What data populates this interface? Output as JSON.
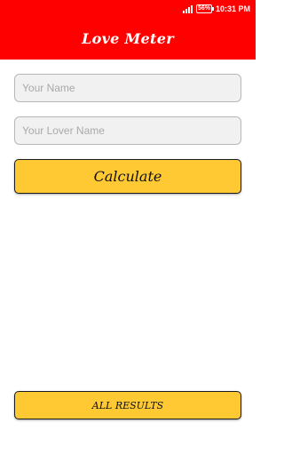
{
  "status_bar": {
    "battery": "56%",
    "time": "10:31 PM"
  },
  "app_bar": {
    "title": "Love Meter"
  },
  "form": {
    "name_placeholder": "Your Name",
    "name_value": "",
    "lover_placeholder": "Your Lover Name",
    "lover_value": "",
    "calculate_label": "Calculate"
  },
  "footer": {
    "all_results_label": "ALL RESULTS"
  },
  "colors": {
    "header": "#ff0000",
    "button": "#ffc934"
  }
}
